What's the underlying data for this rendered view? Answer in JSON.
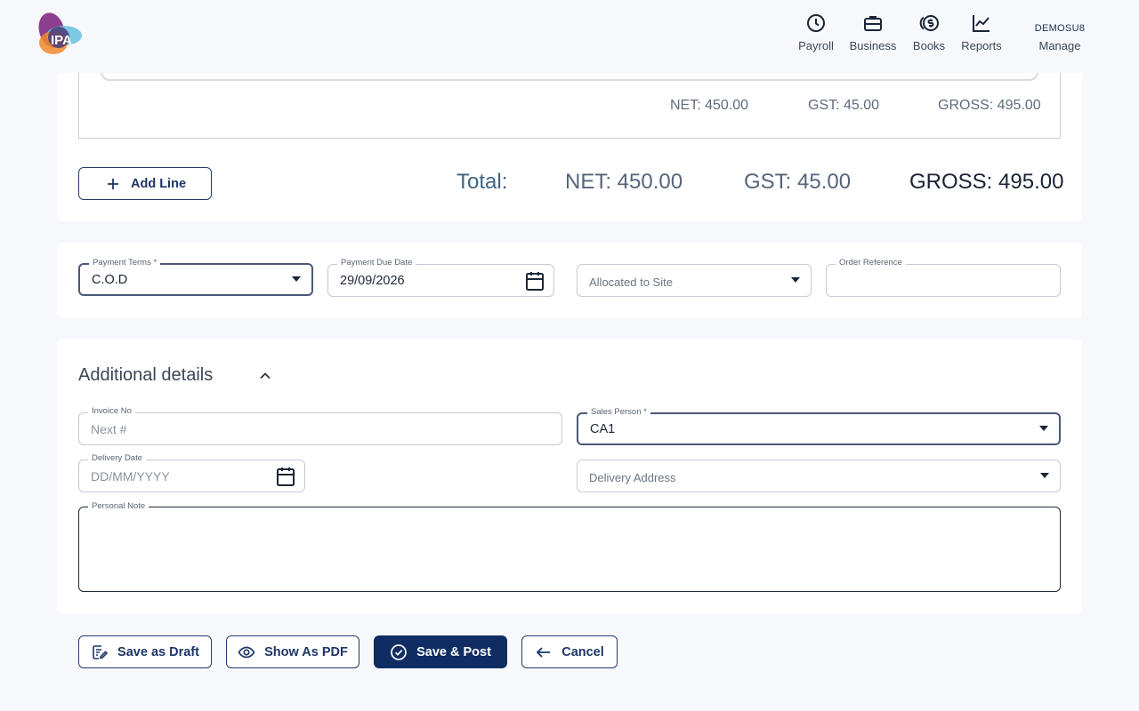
{
  "header": {
    "nav": [
      {
        "label": "Payroll",
        "icon": "clock-icon"
      },
      {
        "label": "Business",
        "icon": "briefcase-icon"
      },
      {
        "label": "Books",
        "icon": "dollar-coins-icon"
      },
      {
        "label": "Reports",
        "icon": "chart-line-icon"
      }
    ],
    "user": {
      "name": "DEMOSU8",
      "label": "Manage"
    }
  },
  "lines": {
    "subtotal_net": "NET: 450.00",
    "subtotal_gst": "GST: 45.00",
    "subtotal_gross": "GROSS: 495.00"
  },
  "add_line_label": "Add Line",
  "totals": {
    "label": "Total:",
    "net": "NET: 450.00",
    "gst": "GST: 45.00",
    "gross": "GROSS: 495.00"
  },
  "payment": {
    "terms_label": "Payment Terms *",
    "terms_value": "C.O.D",
    "due_label": "Payment Due Date",
    "due_value": "29/09/2026",
    "site_placeholder": "Allocated to Site",
    "order_ref_label": "Order Reference"
  },
  "additional": {
    "title": "Additional details",
    "invoice_label": "Invoice No",
    "invoice_placeholder": "Next #",
    "sales_label": "Sales Person *",
    "sales_value": "CA1",
    "delivery_date_label": "Delivery Date",
    "delivery_date_placeholder": "DD/MM/YYYY",
    "delivery_address_placeholder": "Delivery Address",
    "note_label": "Personal Note"
  },
  "actions": {
    "draft": "Save as Draft",
    "pdf": "Show As PDF",
    "post": "Save & Post",
    "cancel": "Cancel"
  },
  "colors": {
    "primary": "#0f2d63",
    "background": "#f6f8fb",
    "total_label": "#3d6487"
  }
}
